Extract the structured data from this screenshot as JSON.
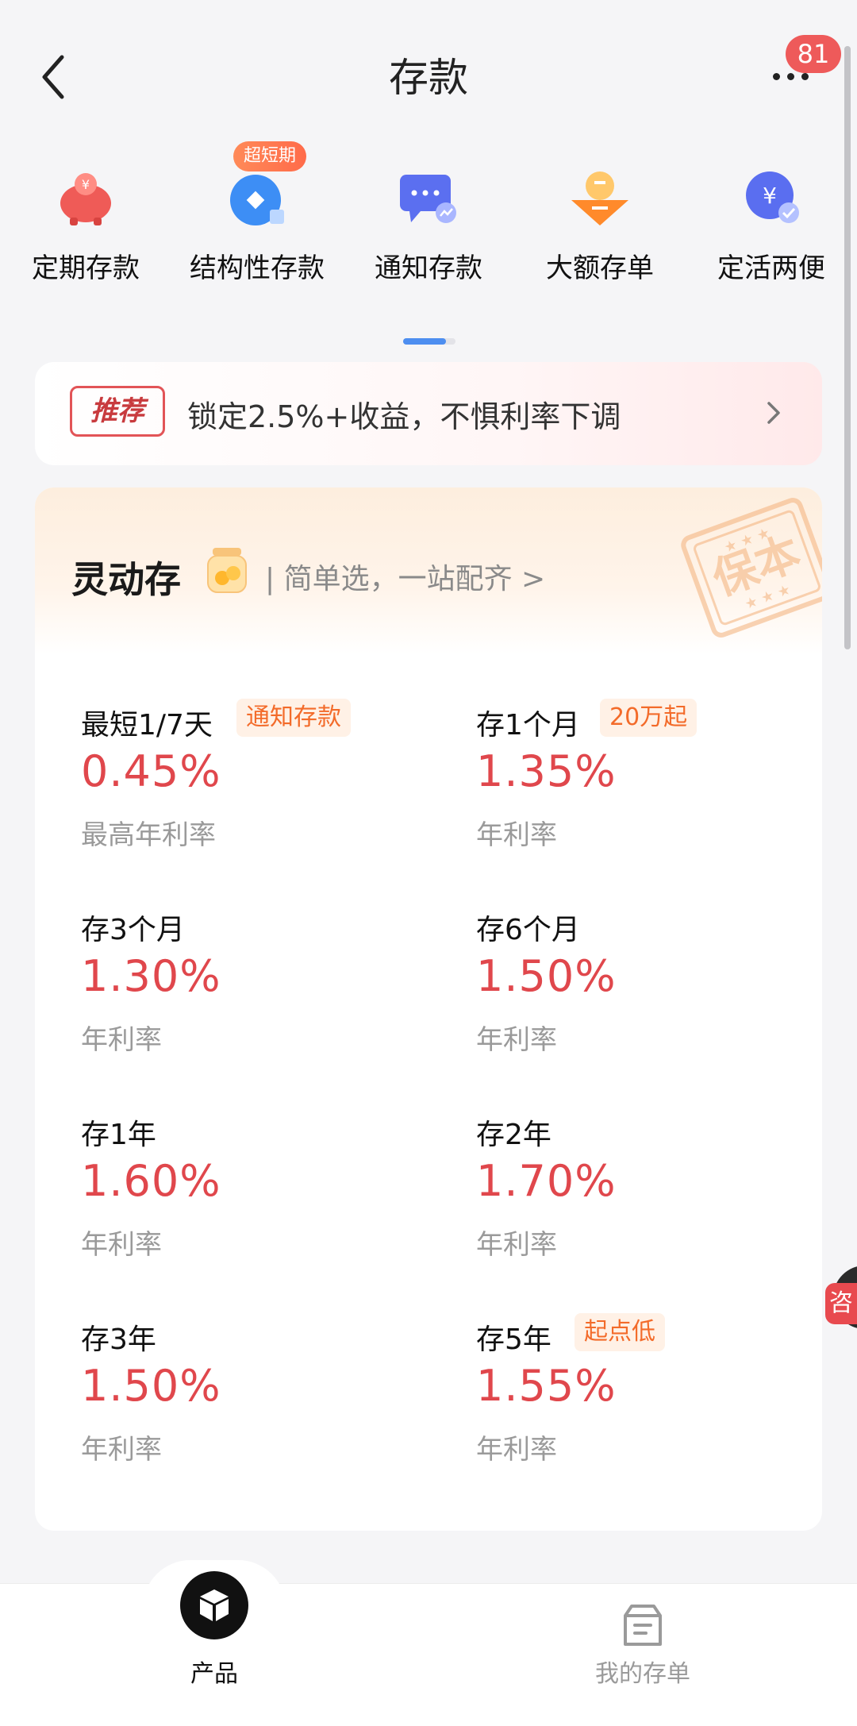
{
  "header": {
    "title": "存款",
    "badge_count": "81"
  },
  "categories": [
    {
      "label": "定期存款",
      "icon": "piggy-bank-icon"
    },
    {
      "label": "结构性存款",
      "icon": "structured-deposit-icon",
      "tag": "超短期"
    },
    {
      "label": "通知存款",
      "icon": "notice-chat-icon"
    },
    {
      "label": "大额存单",
      "icon": "large-deposit-icon"
    },
    {
      "label": "定活两便",
      "icon": "flexible-deposit-icon"
    }
  ],
  "recommend": {
    "tag": "推荐",
    "text": "锁定2.5%+收益，不惧利率下调"
  },
  "card": {
    "title": "灵动存",
    "subtitle": "| 简单选，一站配齐 >",
    "stamp": "保本",
    "items": [
      {
        "name": "最短1/7天",
        "tag": "通知存款",
        "rate": "0.45%",
        "desc": "最高年利率"
      },
      {
        "name": "存1个月",
        "tag": "20万起",
        "rate": "1.35%",
        "desc": "年利率"
      },
      {
        "name": "存3个月",
        "rate": "1.30%",
        "desc": "年利率"
      },
      {
        "name": "存6个月",
        "rate": "1.50%",
        "desc": "年利率"
      },
      {
        "name": "存1年",
        "rate": "1.60%",
        "desc": "年利率"
      },
      {
        "name": "存2年",
        "rate": "1.70%",
        "desc": "年利率"
      },
      {
        "name": "存3年",
        "rate": "1.50%",
        "desc": "年利率"
      },
      {
        "name": "存5年",
        "tag": "起点低",
        "rate": "1.55%",
        "desc": "年利率"
      }
    ]
  },
  "consult_label": "咨",
  "nav": {
    "product_label": "产品",
    "orders_label": "我的存单"
  },
  "colors": {
    "rate_red": "#e0474c",
    "tag_orange": "#f36b2a",
    "accent_blue": "#4d8ef0",
    "badge_red": "#ee5a5a"
  }
}
